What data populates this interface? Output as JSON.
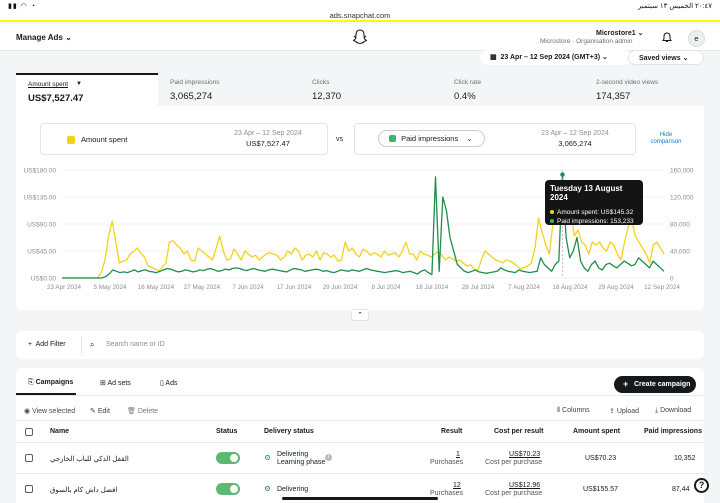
{
  "status_bar": {
    "time": "٢٠:٤٧ الخميس ١٣ سبتمبر",
    "url": "ads.snapchat.com"
  },
  "header": {
    "title": "Manage Ads",
    "org_name": "Microstore1",
    "org_sub": "Microstore · Organisation admin",
    "avatar_letter": "e"
  },
  "toolbar": {
    "date_range": "23 Apr – 12 Sep 2024 (GMT+3)",
    "saved_views": "Saved views"
  },
  "metrics": [
    {
      "label": "Amount spent",
      "value": "US$7,527.47"
    },
    {
      "label": "Paid impressions",
      "value": "3,065,274"
    },
    {
      "label": "Clicks",
      "value": "12,370"
    },
    {
      "label": "Click rate",
      "value": "0.4%"
    },
    {
      "label": "2-second video views",
      "value": "174,357"
    }
  ],
  "comparison": {
    "left_metric": "Amount spent",
    "left_date": "23 Apr – 12 Sep 2024",
    "left_value": "US$7,527.47",
    "vs": "vs",
    "right_metric": "Paid impressions",
    "right_date": "23 Apr – 12 Sep 2024",
    "right_value": "3,065,274",
    "hide": "Hide comparison"
  },
  "chart_data": {
    "type": "line",
    "x_ticks": [
      "23 Apr 2024",
      "5 May 2024",
      "16 May 2024",
      "27 May 2024",
      "7 Jun 2024",
      "17 Jun 2024",
      "29 Jun 2024",
      "8 Jul 2024",
      "18 Jul 2024",
      "28 Jul 2024",
      "7 Aug 2024",
      "18 Aug 2024",
      "29 Aug 2024",
      "12 Sep 2024"
    ],
    "y_left_ticks": [
      "US$180.00",
      "US$135.00",
      "US$90.00",
      "US$45.00",
      "US$0.00"
    ],
    "y_right_ticks": [
      "160,000",
      "120,000",
      "80,000",
      "40,000",
      "0"
    ],
    "y_left_range": [
      0,
      180
    ],
    "y_right_range": [
      0,
      160000
    ],
    "colors": {
      "amount": "#f2d31b",
      "impressions": "#1e8e4a"
    },
    "series": [
      {
        "name": "Amount spent",
        "values": [
          0,
          0,
          0,
          0,
          0,
          0,
          0,
          0,
          0,
          0,
          0,
          10,
          30,
          70,
          95,
          60,
          25,
          28,
          30,
          40,
          45,
          50,
          42,
          35,
          20,
          18,
          15,
          12,
          18,
          25,
          60,
          62,
          55,
          50,
          40,
          45,
          30,
          28,
          50,
          45,
          40,
          35,
          30,
          50,
          70,
          45,
          30,
          32,
          48,
          40,
          30,
          45,
          40,
          35,
          38,
          30,
          35,
          40,
          42,
          40,
          38,
          30,
          35,
          45,
          40,
          50,
          45,
          30,
          38,
          40,
          35,
          45,
          30,
          42,
          40,
          35,
          38,
          28,
          30,
          60,
          45,
          50,
          40,
          35,
          48,
          45,
          38,
          42,
          40,
          35,
          45,
          38,
          40,
          42,
          35,
          45,
          60,
          40,
          40,
          30,
          45,
          40,
          38,
          35,
          40,
          44,
          38,
          30,
          35,
          32,
          28,
          30,
          25,
          20,
          22,
          15,
          12,
          30,
          45,
          40,
          35,
          30,
          28,
          25,
          30,
          28,
          25,
          20,
          15,
          18,
          20,
          25,
          50,
          100,
          75,
          55,
          40,
          90,
          145,
          120,
          100,
          105,
          110,
          70,
          80,
          60,
          55,
          40,
          60,
          55,
          60,
          50,
          45,
          60,
          55,
          40,
          30,
          60,
          85,
          95,
          70,
          60,
          50,
          40,
          25,
          55,
          60,
          50,
          40
        ]
      },
      {
        "name": "Paid impressions",
        "values": [
          0,
          0,
          0,
          0,
          0,
          0,
          0,
          0,
          0,
          0,
          0,
          0,
          2000,
          6000,
          12000,
          10000,
          8000,
          9000,
          8000,
          10000,
          12000,
          9000,
          11000,
          12000,
          10000,
          9000,
          8000,
          10000,
          12000,
          14000,
          13000,
          11000,
          9000,
          10000,
          12000,
          11000,
          9000,
          10000,
          12000,
          11000,
          13000,
          14000,
          12000,
          10000,
          11000,
          13000,
          12000,
          14000,
          15000,
          14000,
          12000,
          11000,
          13000,
          14000,
          12000,
          11000,
          10000,
          12000,
          13000,
          12000,
          11000,
          10000,
          9000,
          12000,
          14000,
          13000,
          12000,
          10000,
          11000,
          12000,
          13000,
          12000,
          10000,
          11000,
          9000,
          8000,
          10000,
          12000,
          11000,
          10000,
          12000,
          11000,
          10000,
          12000,
          14000,
          12000,
          11000,
          10000,
          9000,
          8000,
          9000,
          10000,
          11000,
          10000,
          8000,
          9000,
          10000,
          8000,
          6000,
          10000,
          12000,
          8000,
          5000,
          150000,
          10000,
          120000,
          100000,
          60000,
          40000,
          20000,
          15000,
          10000,
          8000,
          10000,
          12000,
          9000,
          8000,
          7000,
          8000,
          9000,
          10000,
          15000,
          12000,
          10000,
          9000,
          8000,
          12000,
          10000,
          9000,
          8000,
          9000,
          10000,
          30000,
          20000,
          15000,
          10000,
          20000,
          25000,
          153233,
          60000,
          30000,
          40000,
          60000,
          25000,
          15000,
          10000,
          20000,
          25000,
          15000,
          12000,
          20000,
          22000,
          18000,
          15000,
          20000,
          25000,
          22000,
          18000,
          20000,
          30000,
          25000,
          20000,
          15000,
          25000,
          20000,
          15000,
          10000
        ]
      }
    ]
  },
  "tooltip": {
    "title": "Tuesday 13 August 2024",
    "amount": "Amount spent: US$145.32",
    "impressions": "Paid impressions: 153,233"
  },
  "filter": {
    "add_filter": "Add Filter",
    "search_placeholder": "Search name or ID"
  },
  "table": {
    "tabs": [
      "Campaigns",
      "Ad sets",
      "Ads"
    ],
    "create": "Create campaign",
    "actions": {
      "view": "View selected",
      "edit": "Edit",
      "delete": "Delete",
      "columns": "Columns",
      "upload": "Upload",
      "download": "Download"
    },
    "headers": [
      "Name",
      "Status",
      "Delivery status",
      "Result",
      "Cost per result",
      "Amount spent",
      "Paid impressions"
    ],
    "rows": [
      {
        "name": "القفل الذكي للباب الخارجي",
        "delivery": "Delivering",
        "delivery_sub": "Learning phase",
        "result": "1",
        "result_sub": "Purchases",
        "cpr": "US$70.23",
        "cpr_sub": "Cost per purchase",
        "spent": "US$70.23",
        "impressions": "10,352"
      },
      {
        "name": "افضل داش كام بالسوق",
        "delivery": "Delivering",
        "delivery_sub": "",
        "result": "12",
        "result_sub": "Purchases",
        "cpr": "US$12.96",
        "cpr_sub": "Cost per purchase",
        "spent": "US$155.57",
        "impressions": "87,44"
      }
    ]
  }
}
